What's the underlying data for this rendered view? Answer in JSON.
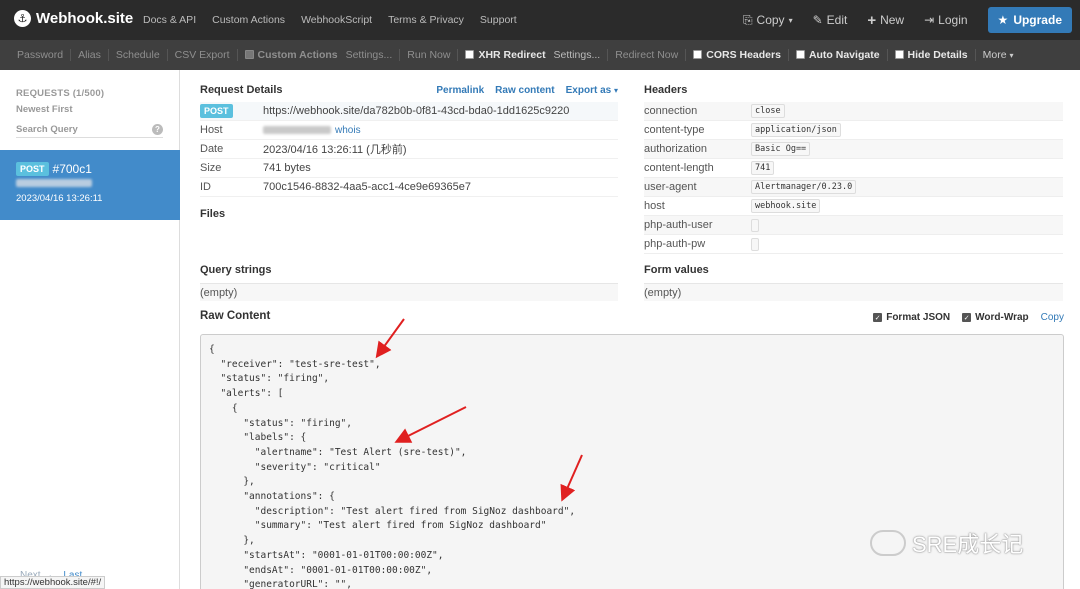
{
  "topbar": {
    "brand": "Webhook.site",
    "nav": [
      "Docs & API",
      "Custom Actions",
      "WebhookScript",
      "Terms & Privacy",
      "Support"
    ],
    "copy_label": "Copy",
    "edit_label": "Edit",
    "new_label": "New",
    "login_label": "Login",
    "upgrade_label": "Upgrade"
  },
  "secbar": {
    "password": "Password",
    "alias": "Alias",
    "schedule": "Schedule",
    "csv_export": "CSV Export",
    "custom_actions": "Custom Actions",
    "settings1": "Settings...",
    "run_now": "Run Now",
    "xhr_redirect": "XHR Redirect",
    "settings2": "Settings...",
    "redirect_now": "Redirect Now",
    "cors_headers": "CORS Headers",
    "auto_navigate": "Auto Navigate",
    "hide_details": "Hide Details",
    "more": "More"
  },
  "sidebar": {
    "requests_header": "REQUESTS (1/500)",
    "sort": "Newest First",
    "search_placeholder": "Search Query",
    "item": {
      "method": "POST",
      "id": "#700c1",
      "time": "2023/04/16 13:26:11"
    },
    "pager_next": "Next →",
    "pager_last": "Last"
  },
  "status_url": "https://webhook.site/#!/",
  "request_details": {
    "title": "Request Details",
    "permalink": "Permalink",
    "raw_content_link": "Raw content",
    "export_as": "Export as",
    "method": "POST",
    "url": "https://webhook.site/da782b0b-0f81-43cd-bda0-1dd1625c9220",
    "host_label": "Host",
    "whois": "whois",
    "date_label": "Date",
    "date_value": "2023/04/16 13:26:11 (几秒前)",
    "size_label": "Size",
    "size_value": "741 bytes",
    "id_label": "ID",
    "id_value": "700c1546-8832-4aa5-acc1-4ce9e69365e7"
  },
  "files": {
    "title": "Files"
  },
  "headers": {
    "title": "Headers",
    "rows": [
      {
        "k": "connection",
        "v": "close"
      },
      {
        "k": "content-type",
        "v": "application/json"
      },
      {
        "k": "authorization",
        "v": "Basic Og=="
      },
      {
        "k": "content-length",
        "v": "741"
      },
      {
        "k": "user-agent",
        "v": "Alertmanager/0.23.0"
      },
      {
        "k": "host",
        "v": "webhook.site"
      },
      {
        "k": "php-auth-user",
        "v": ""
      },
      {
        "k": "php-auth-pw",
        "v": ""
      }
    ]
  },
  "query_strings": {
    "title": "Query strings",
    "value": "(empty)"
  },
  "form_values": {
    "title": "Form values",
    "value": "(empty)"
  },
  "raw_content": {
    "title": "Raw Content",
    "format_json": "Format JSON",
    "word_wrap": "Word-Wrap",
    "copy": "Copy",
    "body": "{\n  \"receiver\": \"test-sre-test\",\n  \"status\": \"firing\",\n  \"alerts\": [\n    {\n      \"status\": \"firing\",\n      \"labels\": {\n        \"alertname\": \"Test Alert (sre-test)\",\n        \"severity\": \"critical\"\n      },\n      \"annotations\": {\n        \"description\": \"Test alert fired from SigNoz dashboard\",\n        \"summary\": \"Test alert fired from SigNoz dashboard\"\n      },\n      \"startsAt\": \"0001-01-01T00:00:00Z\",\n      \"endsAt\": \"0001-01-01T00:00:00Z\",\n      \"generatorURL\": \"\","
  },
  "watermark": "SRE成长记",
  "colors": {
    "topbar": "#2b2b2b",
    "secbar": "#3f3f3f",
    "accent": "#337ab7",
    "selected": "#428bca",
    "badge": "#5bc0de",
    "arrow": "#e02020"
  }
}
